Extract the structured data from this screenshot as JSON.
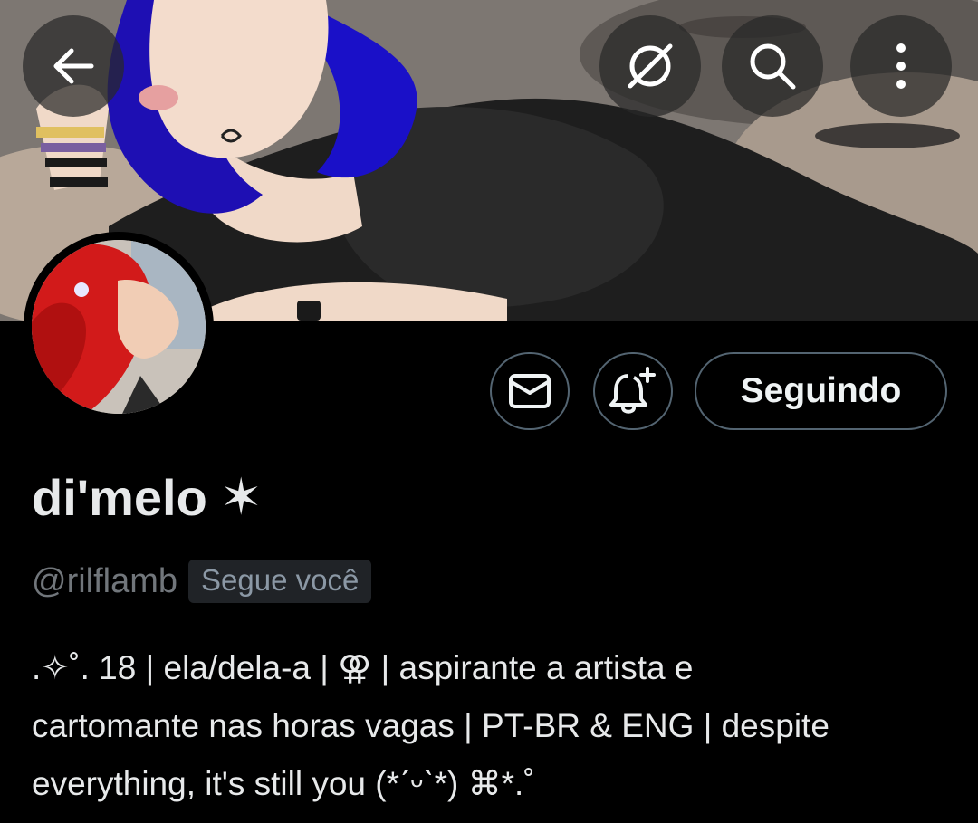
{
  "header": {
    "back_icon": "arrow-left-icon",
    "grok_icon": "grok-icon",
    "search_icon": "search-icon",
    "more_icon": "more-vertical-icon"
  },
  "profile": {
    "display_name": "di'melo",
    "name_emoji": "✶",
    "handle": "@rilflamb",
    "follows_you_label": "Segue você",
    "bio_lines": [
      ".✧˚. 18 | ela/dela-a | ⚢ | aspirante a artista e",
      "cartomante nas horas vagas | PT-BR & ENG | despite",
      "everything, it's still you (*ˊᵕˋ*) ⌘*.˚"
    ]
  },
  "actions": {
    "message_icon": "mail-icon",
    "notify_icon": "bell-plus-icon",
    "follow_label": "Seguindo"
  },
  "colors": {
    "background": "#000000",
    "text": "#e7e9ea",
    "muted": "#71767b",
    "border": "#536471"
  }
}
